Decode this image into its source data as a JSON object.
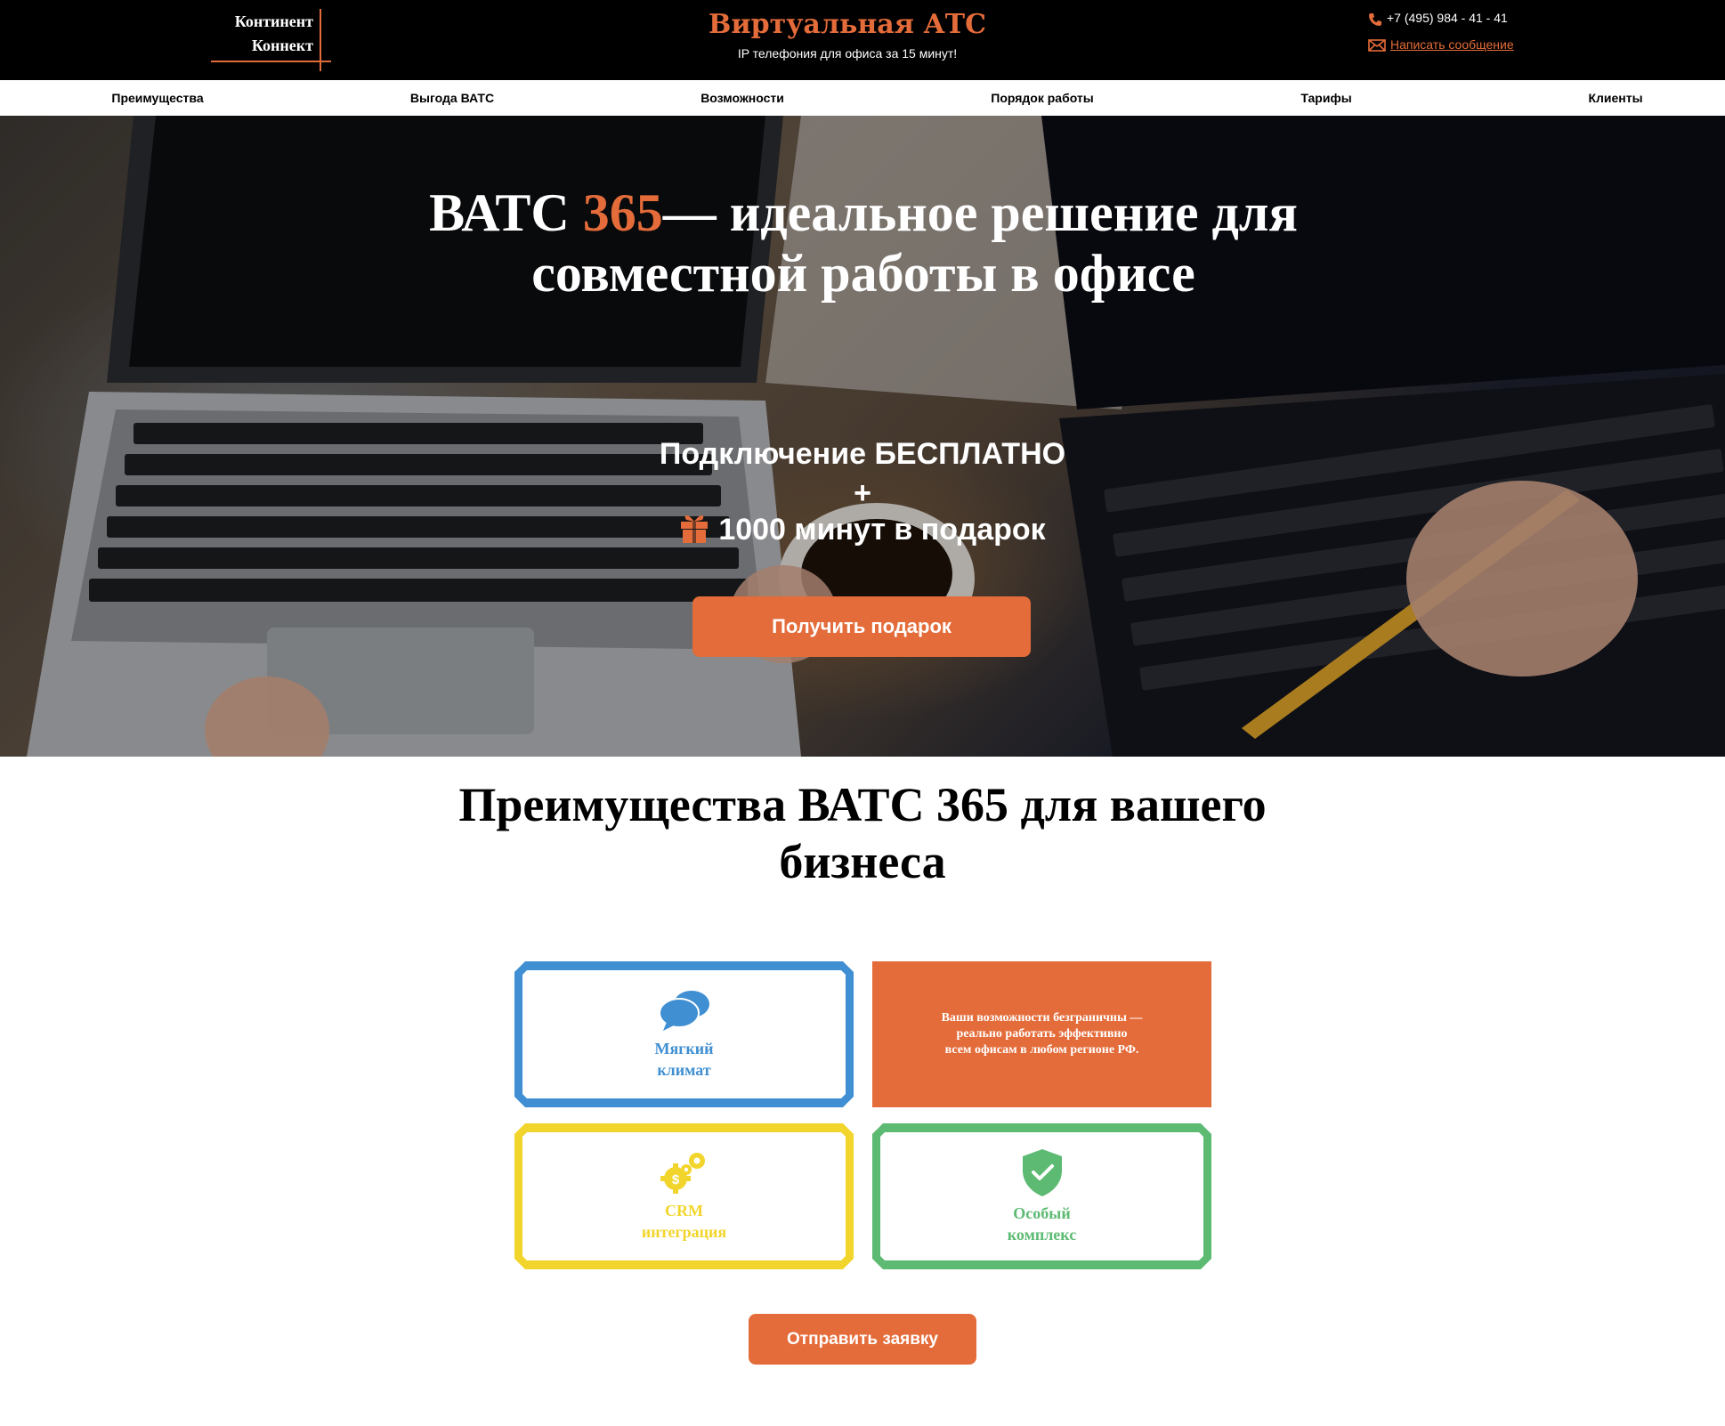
{
  "header": {
    "logo_line1": "Континент",
    "logo_line2": "Коннект",
    "title": "Виртуальная АТС",
    "subtitle": "IP телефония для офиса за 15 минут!",
    "phone": "+7 (495) 984 - 41 - 41",
    "message_link": "Написать сообщение"
  },
  "nav": {
    "items": [
      {
        "label": "Преимущества"
      },
      {
        "label": "Выгода ВАТС"
      },
      {
        "label": "Возможности"
      },
      {
        "label": "Порядок работы"
      },
      {
        "label": "Тарифы"
      },
      {
        "label": "Клиенты"
      }
    ]
  },
  "hero": {
    "title_part1": "ВАТС ",
    "title_accent": "365",
    "title_part2": "— идеальное решение для совместной работы в офисе",
    "offer_line1": "Подключение БЕСПЛАТНО",
    "offer_plus": "+",
    "offer_line3": "1000 минут в подарок",
    "button": "Получить подарок"
  },
  "advantages": {
    "title": "Преимущества ВАТС 365 для вашего бизнеса",
    "cards": [
      {
        "label": "Мягкий\nклимат",
        "icon": "chat-bubbles-icon",
        "color": "#3f8fd2"
      },
      {
        "label": "Ваши возможности безграничны —\nреально работать эффективно\nвсем офисам в любом регионе РФ.",
        "color": "#e46c3a"
      },
      {
        "label": "CRM\nинтеграция",
        "icon": "gears-dollar-icon",
        "color": "#f2d52c"
      },
      {
        "label": "Особый\nкомплекс",
        "icon": "shield-check-icon",
        "color": "#5cba72"
      }
    ],
    "button": "Отправить заявку"
  },
  "colors": {
    "accent": "#e46c3a",
    "header_bg": "#000000"
  }
}
